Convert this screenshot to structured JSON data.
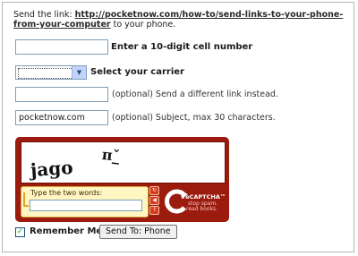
{
  "intro": {
    "prefix": "Send the link: ",
    "link": "http://pocketnow.com/how-to/send-links-to-your-phone-from-your-computer",
    "suffix": " to your phone."
  },
  "form": {
    "cell_label": "Enter a 10-digit cell number",
    "cell_value": "",
    "carrier_label": "Select your carrier",
    "carrier_value": "",
    "alt_link_label": "(optional) Send a different link instead.",
    "alt_link_value": "",
    "subject_label": "(optional) Subject, max 30 characters.",
    "subject_value": "pocketnow.com"
  },
  "captcha": {
    "words": [
      "jago",
      "π_̌"
    ],
    "prompt": "Type the two words:",
    "answer": "",
    "brand": "reCAPTCHA™",
    "tagline_1": "stop spam.",
    "tagline_2": "read books.",
    "colors": {
      "frame": "#9c1b0f",
      "prompt_bg": "#fff6c2",
      "button": "#d93b1e"
    },
    "buttons": [
      "refresh-icon",
      "audio-icon",
      "help-icon"
    ]
  },
  "remember_label": "Remember Me",
  "remember_checked": true,
  "send_label": "Send To: Phone"
}
